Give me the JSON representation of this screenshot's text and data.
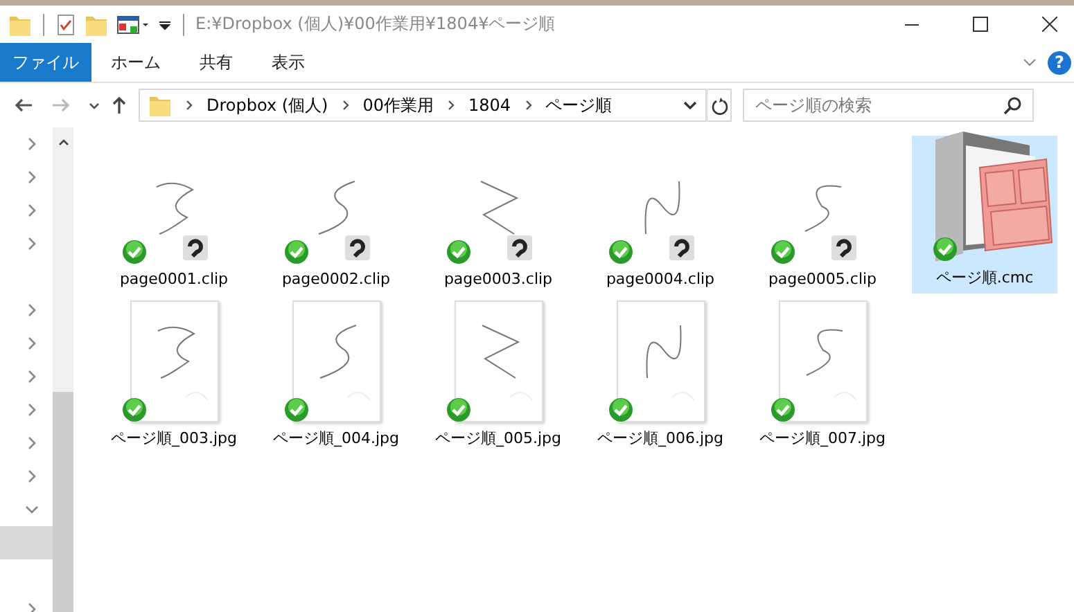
{
  "window": {
    "title": "E:¥Dropbox (個人)¥00作業用¥1804¥ページ順"
  },
  "ribbon": {
    "tabs": [
      {
        "label": "ファイル",
        "kind": "file"
      },
      {
        "label": "ホーム",
        "kind": "tab"
      },
      {
        "label": "共有",
        "kind": "tab"
      },
      {
        "label": "表示",
        "kind": "tab"
      }
    ],
    "help": "?"
  },
  "address_bar": {
    "back_disabled": false,
    "forward_disabled": true,
    "path": [
      "Dropbox (個人)",
      "00作業用",
      "1804",
      "ページ順"
    ]
  },
  "search": {
    "placeholder": "ページ順の検索"
  },
  "nav_pane": {
    "items": [
      {
        "kind": "node",
        "expanded": false,
        "selected": false
      },
      {
        "kind": "node",
        "expanded": false,
        "selected": false
      },
      {
        "kind": "node",
        "expanded": false,
        "selected": false
      },
      {
        "kind": "node",
        "expanded": false,
        "selected": false
      },
      {
        "kind": "leaf",
        "selected": false
      },
      {
        "kind": "node",
        "expanded": false,
        "selected": false
      },
      {
        "kind": "node",
        "expanded": false,
        "selected": false
      },
      {
        "kind": "node",
        "expanded": false,
        "selected": false
      },
      {
        "kind": "node",
        "expanded": false,
        "selected": false
      },
      {
        "kind": "node",
        "expanded": false,
        "selected": false
      },
      {
        "kind": "node",
        "expanded": false,
        "selected": false
      },
      {
        "kind": "node",
        "expanded": true,
        "selected": false
      },
      {
        "kind": "leaf",
        "selected": true
      },
      {
        "kind": "leaf",
        "selected": false
      },
      {
        "kind": "node",
        "expanded": false,
        "selected": false
      }
    ]
  },
  "files": [
    {
      "name": "page0001.clip",
      "kind": "clip",
      "synced": true,
      "selected": false
    },
    {
      "name": "page0002.clip",
      "kind": "clip",
      "synced": true,
      "selected": false
    },
    {
      "name": "page0003.clip",
      "kind": "clip",
      "synced": true,
      "selected": false
    },
    {
      "name": "page0004.clip",
      "kind": "clip",
      "synced": true,
      "selected": false
    },
    {
      "name": "page0005.clip",
      "kind": "clip",
      "synced": true,
      "selected": false
    },
    {
      "name": "ページ順.cmc",
      "kind": "cmc",
      "synced": true,
      "selected": true
    },
    {
      "name": "ページ順_003.jpg",
      "kind": "jpg",
      "synced": true,
      "selected": false
    },
    {
      "name": "ページ順_004.jpg",
      "kind": "jpg",
      "synced": true,
      "selected": false
    },
    {
      "name": "ページ順_005.jpg",
      "kind": "jpg",
      "synced": true,
      "selected": false
    },
    {
      "name": "ページ順_006.jpg",
      "kind": "jpg",
      "synced": true,
      "selected": false
    },
    {
      "name": "ページ順_007.jpg",
      "kind": "jpg",
      "synced": true,
      "selected": false
    }
  ]
}
